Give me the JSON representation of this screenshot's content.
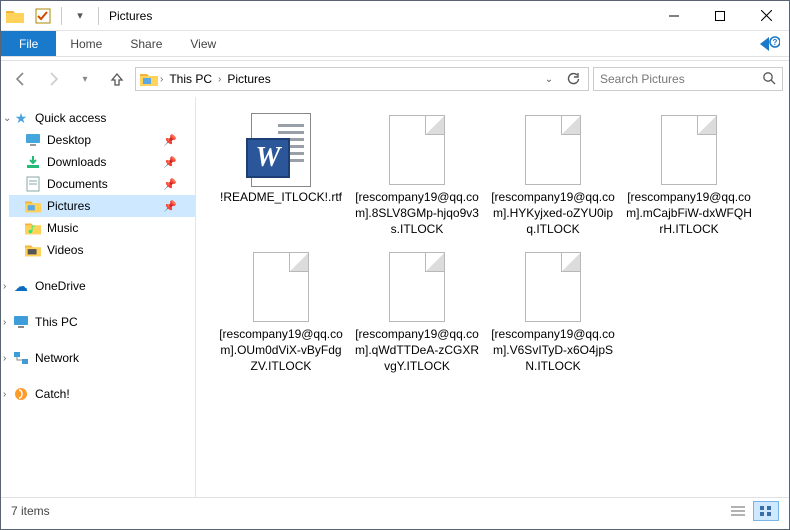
{
  "title": "Pictures",
  "ribbon": {
    "file": "File",
    "tabs": [
      "Home",
      "Share",
      "View"
    ]
  },
  "breadcrumb": {
    "root": "This PC",
    "current": "Pictures"
  },
  "search": {
    "placeholder": "Search Pictures"
  },
  "nav": {
    "quick": "Quick access",
    "items": [
      {
        "label": "Desktop",
        "pinned": true
      },
      {
        "label": "Downloads",
        "pinned": true
      },
      {
        "label": "Documents",
        "pinned": true
      },
      {
        "label": "Pictures",
        "pinned": true,
        "selected": true
      },
      {
        "label": "Music",
        "pinned": false
      },
      {
        "label": "Videos",
        "pinned": false
      }
    ],
    "onedrive": "OneDrive",
    "thispc": "This PC",
    "network": "Network",
    "catch": "Catch!"
  },
  "files": [
    {
      "name": "!README_ITLOCK!.rtf",
      "type": "word"
    },
    {
      "name": "[rescompany19@qq.com].8SLV8GMp-hjqo9v3s.ITLOCK",
      "type": "file"
    },
    {
      "name": "[rescompany19@qq.com].HYKyjxed-oZYU0ipq.ITLOCK",
      "type": "file"
    },
    {
      "name": "[rescompany19@qq.com].mCajbFiW-dxWFQHrH.ITLOCK",
      "type": "file"
    },
    {
      "name": "[rescompany19@qq.com].OUm0dViX-vByFdgZV.ITLOCK",
      "type": "file"
    },
    {
      "name": "[rescompany19@qq.com].qWdTTDeA-zCGXRvgY.ITLOCK",
      "type": "file"
    },
    {
      "name": "[rescompany19@qq.com].V6SvITyD-x6O4jpSN.ITLOCK",
      "type": "file"
    }
  ],
  "status": {
    "count": "7 items"
  }
}
